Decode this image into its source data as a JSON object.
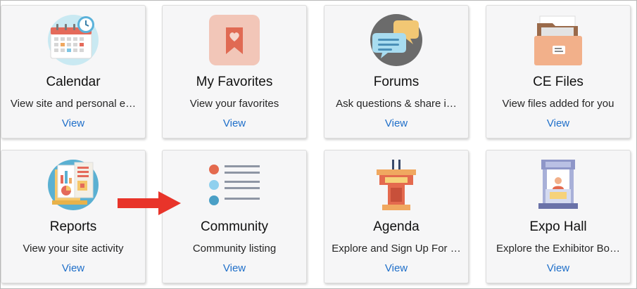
{
  "cards": [
    {
      "title": "Calendar",
      "description": "View site and personal e…",
      "link": "View",
      "icon": "calendar-icon"
    },
    {
      "title": "My Favorites",
      "description": "View your favorites",
      "link": "View",
      "icon": "bookmark-heart-icon"
    },
    {
      "title": "Forums",
      "description": "Ask questions & share i…",
      "link": "View",
      "icon": "chat-bubbles-icon"
    },
    {
      "title": "CE Files",
      "description": "View files added for you",
      "link": "View",
      "icon": "file-drawer-icon"
    },
    {
      "title": "Reports",
      "description": "View your site activity",
      "link": "View",
      "icon": "report-charts-icon"
    },
    {
      "title": "Community",
      "description": "Community listing",
      "link": "View",
      "icon": "list-icon"
    },
    {
      "title": "Agenda",
      "description": "Explore and Sign Up For …",
      "link": "View",
      "icon": "podium-icon"
    },
    {
      "title": "Expo Hall",
      "description": "Explore the Exhibitor Bo…",
      "link": "View",
      "icon": "booth-icon"
    }
  ],
  "colors": {
    "link": "#1f6fc9",
    "arrow": "#e8342a",
    "card_background": "#f6f6f7"
  }
}
